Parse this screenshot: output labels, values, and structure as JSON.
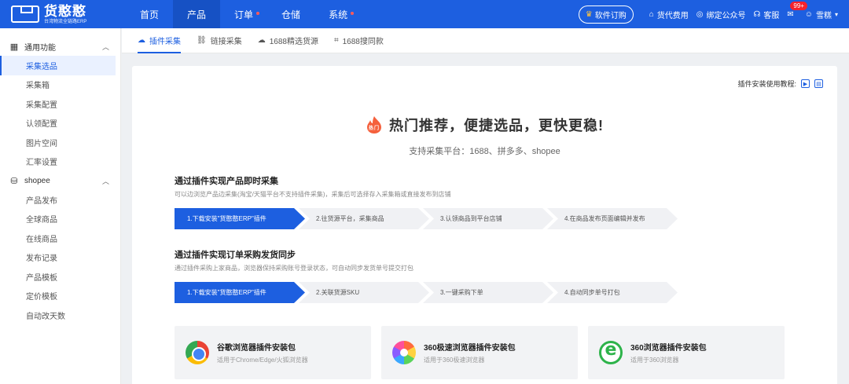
{
  "brand": {
    "name": "货憨憨",
    "sub": "台湾物流全链路ERP"
  },
  "nav": [
    {
      "label": "首页",
      "active": false,
      "dot": false
    },
    {
      "label": "产品",
      "active": true,
      "dot": false
    },
    {
      "label": "订单",
      "active": false,
      "dot": true
    },
    {
      "label": "仓储",
      "active": false,
      "dot": false
    },
    {
      "label": "系统",
      "active": false,
      "dot": true
    }
  ],
  "topright": {
    "order_btn": "软件订购",
    "fee": "货代费用",
    "bind": "绑定公众号",
    "service": "客服",
    "badge": "99+",
    "user": "雪糕"
  },
  "sidebar": {
    "groups": [
      {
        "title": "通用功能",
        "icon": "grid-icon",
        "items": [
          "采集选品",
          "采集箱",
          "采集配置",
          "认领配置",
          "图片空间",
          "汇率设置"
        ]
      },
      {
        "title": "shopee",
        "icon": "bag-icon",
        "items": [
          "产品发布",
          "全球商品",
          "在线商品",
          "发布记录",
          "产品模板",
          "定价模板",
          "自动改天数"
        ]
      }
    ],
    "active_item": "采集选品"
  },
  "tabs": [
    {
      "label": "插件采集",
      "icon": "cloud-icon",
      "active": true
    },
    {
      "label": "链接采集",
      "icon": "link-icon",
      "active": false
    },
    {
      "label": "1688精选货源",
      "icon": "cloud-link-icon",
      "active": false
    },
    {
      "label": "1688搜同款",
      "icon": "scan-icon",
      "active": false
    }
  ],
  "tutorial": "插件安装使用教程:",
  "hero": {
    "title": "热门推荐，便捷选品，更快更稳!",
    "fire_label": "热门",
    "sub": "支持采集平台：1688、拼多多、shopee"
  },
  "sections": [
    {
      "title": "通过插件实现产品即时采集",
      "desc": "可以边浏览产品边采集(淘宝/天猫平台不支持插件采集)，采集后可选择存入采集箱或直接发布到店铺",
      "steps": [
        "1.下载安装\"货憨憨ERP\"插件",
        "2.往货源平台，采集商品",
        "3.认领商品到平台店铺",
        "4.在商品发布页面编辑并发布"
      ]
    },
    {
      "title": "通过插件实现订单采购发货同步",
      "desc": "通过插件采购上家商品，浏览器保持采购账号登录状态，可自动同步发货单号提交打包",
      "steps": [
        "1.下载安装\"货憨憨ERP\"插件",
        "2.关联货源SKU",
        "3.一键采购下单",
        "4.自动同步单号打包"
      ]
    }
  ],
  "cards": [
    {
      "title": "谷歌浏览器插件安装包",
      "sub": "适用于Chrome/Edge/火狐浏览器",
      "icon": "chrome-icon"
    },
    {
      "title": "360极速浏览器插件安装包",
      "sub": "适用于360极速浏览器",
      "icon": "360-speed-icon"
    },
    {
      "title": "360浏览器插件安装包",
      "sub": "适用于360浏览器",
      "icon": "360-browser-icon"
    }
  ]
}
